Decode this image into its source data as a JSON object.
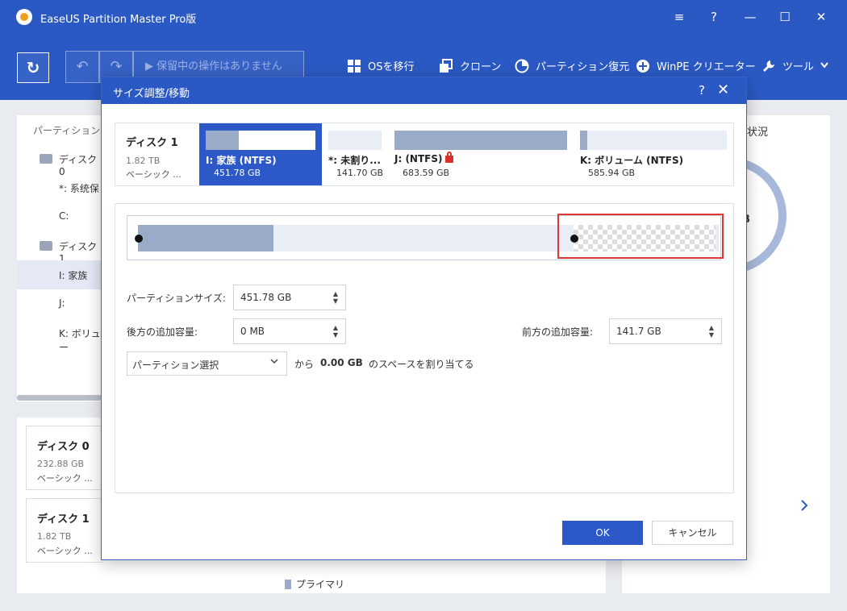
{
  "app": {
    "title": "EaseUS Partition Master Pro版"
  },
  "window": {
    "menu": "≡",
    "help": "?",
    "minimize": "—",
    "maximize": "☐",
    "close": "✕"
  },
  "toolbar": {
    "refresh": "↻",
    "undo": "↶",
    "redo": "↷",
    "pending": "▶ 保留中の操作はありません",
    "migrate_os": "OSを移行",
    "clone": "クローン",
    "recover": "パーティション復元",
    "winpe": "WinPE クリエーター",
    "tools": "ツール"
  },
  "left_panel": {
    "header": "パーティション",
    "rows": [
      {
        "label": "ディスク 0"
      },
      {
        "label": "*: 系统保"
      },
      {
        "label": "C:"
      },
      {
        "label": "ディスク 1"
      },
      {
        "label": "I: 家族"
      },
      {
        "label": "J:"
      },
      {
        "label": "K: ボリュー"
      }
    ]
  },
  "disk_cards": [
    {
      "name": "ディスク 0",
      "size": "232.88 GB",
      "type": "ベーシック ..."
    },
    {
      "name": "ディスク 1",
      "size": "1.82 TB",
      "type": "ベーシック ..."
    }
  ],
  "legend": {
    "primary": "プライマリ"
  },
  "right_panel": {
    "status": "状況",
    "ring_text": "B"
  },
  "dialog": {
    "title": "サイズ調整/移動",
    "help": "?",
    "close": "✕",
    "disk": {
      "name": "ディスク 1",
      "size": "1.82 TB",
      "type": "ベーシック ..."
    },
    "partitions": [
      {
        "name": "I: 家族 (NTFS)",
        "size": "451.78 GB",
        "fill": 0.3
      },
      {
        "name": "*: 未割り...",
        "size": "141.70 GB"
      },
      {
        "name": "J: (NTFS)",
        "size": "683.59 GB",
        "fill": 1.0
      },
      {
        "name": "K: ボリューム (NTFS)",
        "size": "585.94 GB",
        "fill": 0.05
      }
    ],
    "fields": {
      "partition_size_label": "パーティションサイズ:",
      "partition_size_value": "451.78 GB",
      "after_label": "後方の追加容量:",
      "after_value": "0 MB",
      "before_label": "前方の追加容量:",
      "before_value": "141.7 GB",
      "select_partition": "パーティション選択",
      "from": "から",
      "amount": "0.00 GB",
      "assign_text": "のスペースを割り当てる"
    },
    "ok": "OK",
    "cancel": "キャンセル"
  },
  "colors": {
    "brand": "#2b59c3",
    "used": "#9aabc7",
    "highlight": "#e03636"
  }
}
